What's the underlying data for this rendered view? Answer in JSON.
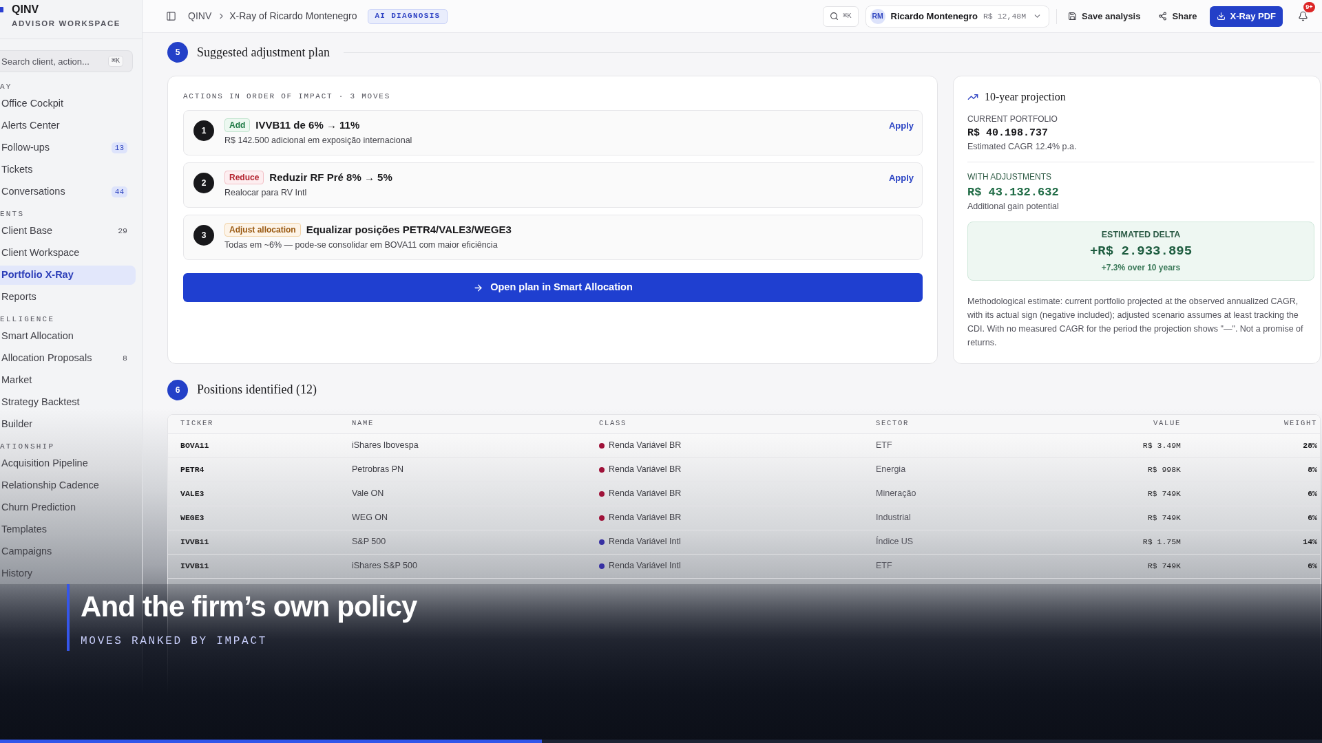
{
  "sidebar": {
    "brand": {
      "name": "QINV",
      "subtitle": "ADVISOR WORKSPACE"
    },
    "search": {
      "placeholder": "Search client, action...",
      "shortcut": "⌘K"
    },
    "sections": [
      {
        "label": "AY",
        "items": [
          {
            "label": "Office Cockpit",
            "selected": false
          },
          {
            "label": "Alerts Center",
            "selected": false
          },
          {
            "label": "Follow-ups",
            "selected": false,
            "badge": {
              "text": "13",
              "kind": "accent"
            }
          },
          {
            "label": "Tickets",
            "selected": false
          },
          {
            "label": "Conversations",
            "selected": false,
            "badge": {
              "text": "44",
              "kind": "accent"
            }
          }
        ]
      },
      {
        "label": "ENTS",
        "items": [
          {
            "label": "Client Base",
            "selected": false,
            "badge": {
              "text": "29",
              "kind": "plain"
            }
          },
          {
            "label": "Client Workspace",
            "selected": false
          },
          {
            "label": "Portfolio X-Ray",
            "selected": true
          },
          {
            "label": "Reports",
            "selected": false
          }
        ]
      },
      {
        "label": "ELLIGENCE",
        "items": [
          {
            "label": "Smart Allocation",
            "selected": false
          },
          {
            "label": "Allocation Proposals",
            "selected": false,
            "badge": {
              "text": "8",
              "kind": "plain"
            }
          },
          {
            "label": "Market",
            "selected": false
          },
          {
            "label": "Strategy Backtest",
            "selected": false
          },
          {
            "label": "Builder",
            "selected": false
          }
        ]
      },
      {
        "label": "ATIONSHIP",
        "items": [
          {
            "label": "Acquisition Pipeline",
            "selected": false
          },
          {
            "label": "Relationship Cadence",
            "selected": false
          },
          {
            "label": "Churn Prediction",
            "selected": false
          },
          {
            "label": "Templates",
            "selected": false
          },
          {
            "label": "Campaigns",
            "selected": false
          },
          {
            "label": "History",
            "selected": false
          }
        ]
      }
    ]
  },
  "header": {
    "breadcrumb": {
      "root": "QINV",
      "current": "X-Ray of Ricardo Montenegro"
    },
    "tag": "AI DIAGNOSIS",
    "search_shortcut": "⌘K",
    "client": {
      "initials": "RM",
      "name": "Ricardo Montenegro",
      "aum": "R$ 12,48M"
    },
    "actions": [
      {
        "label": "Save analysis",
        "kind": "ghost"
      },
      {
        "label": "Share",
        "kind": "ghost"
      },
      {
        "label": "X-Ray PDF",
        "kind": "primary"
      }
    ],
    "notifications": "9+"
  },
  "plan": {
    "number": "5",
    "title": "Suggested adjustment plan",
    "heading": "ACTIONS IN ORDER OF IMPACT · 3 MOVES",
    "actions": [
      {
        "rank": "1",
        "kind": "add",
        "tag": "Add",
        "title": "IVVB11 de 6% → 11%",
        "detail": "R$ 142.500 adicional em exposição internacional",
        "apply": "Apply"
      },
      {
        "rank": "2",
        "kind": "reduce",
        "tag": "Reduce",
        "title": "Reduzir RF Pré 8% → 5%",
        "detail": "Realocar para RV Intl",
        "apply": "Apply"
      },
      {
        "rank": "3",
        "kind": "adjust",
        "tag": "Adjust allocation",
        "title": "Equalizar posições PETR4/VALE3/WEGE3",
        "detail": "Todas em ~6% — pode-se consolidar em BOVA11 com maior eficiência"
      }
    ],
    "button": "Open plan in Smart Allocation"
  },
  "projection": {
    "title": "10-year projection",
    "current": {
      "label": "CURRENT PORTFOLIO",
      "value": "R$ 40.198.737",
      "note": "Estimated CAGR 12.4% p.a."
    },
    "adjusted": {
      "label": "WITH ADJUSTMENTS",
      "value": "R$ 43.132.632",
      "note": "Additional gain potential"
    },
    "delta": {
      "label": "ESTIMATED DELTA",
      "value": "+R$ 2.933.895",
      "note": "+7.3% over 10 years"
    },
    "disclaimer": "Methodological estimate: current portfolio projected at the observed annualized CAGR, with its actual sign (negative included); adjusted scenario assumes at least tracking the CDI. With no measured CAGR for the period the projection shows \"—\". Not a promise of returns."
  },
  "positions": {
    "number": "6",
    "title": "Positions identified (12)",
    "columns": [
      "TICKER",
      "NAME",
      "CLASS",
      "SECTOR",
      "VALUE",
      "WEIGHT"
    ],
    "rows": [
      {
        "ticker": "BOVA11",
        "name": "iShares Ibovespa",
        "class": "Renda Variável BR",
        "color": "#9f1239",
        "sector": "ETF",
        "value": "R$ 3.49M",
        "weight": "28%"
      },
      {
        "ticker": "PETR4",
        "name": "Petrobras PN",
        "class": "Renda Variável BR",
        "color": "#9f1239",
        "sector": "Energia",
        "value": "R$ 998K",
        "weight": "8%"
      },
      {
        "ticker": "VALE3",
        "name": "Vale ON",
        "class": "Renda Variável BR",
        "color": "#9f1239",
        "sector": "Mineração",
        "value": "R$ 749K",
        "weight": "6%"
      },
      {
        "ticker": "WEGE3",
        "name": "WEG ON",
        "class": "Renda Variável BR",
        "color": "#9f1239",
        "sector": "Industrial",
        "value": "R$ 749K",
        "weight": "6%"
      },
      {
        "ticker": "IVVB11",
        "name": "S&P 500",
        "class": "Renda Variável Intl",
        "color": "#3730a3",
        "sector": "Índice US",
        "value": "R$ 1.75M",
        "weight": "14%"
      },
      {
        "ticker": "IVVB11",
        "name": "iShares S&P 500",
        "class": "Renda Variável Intl",
        "color": "#3730a3",
        "sector": "ETF",
        "value": "R$ 749K",
        "weight": "6%"
      }
    ]
  },
  "caption": {
    "title": "And the firm’s own policy",
    "subtitle": "MOVES RANKED BY IMPACT",
    "progress": {
      "level": 0.41
    }
  }
}
